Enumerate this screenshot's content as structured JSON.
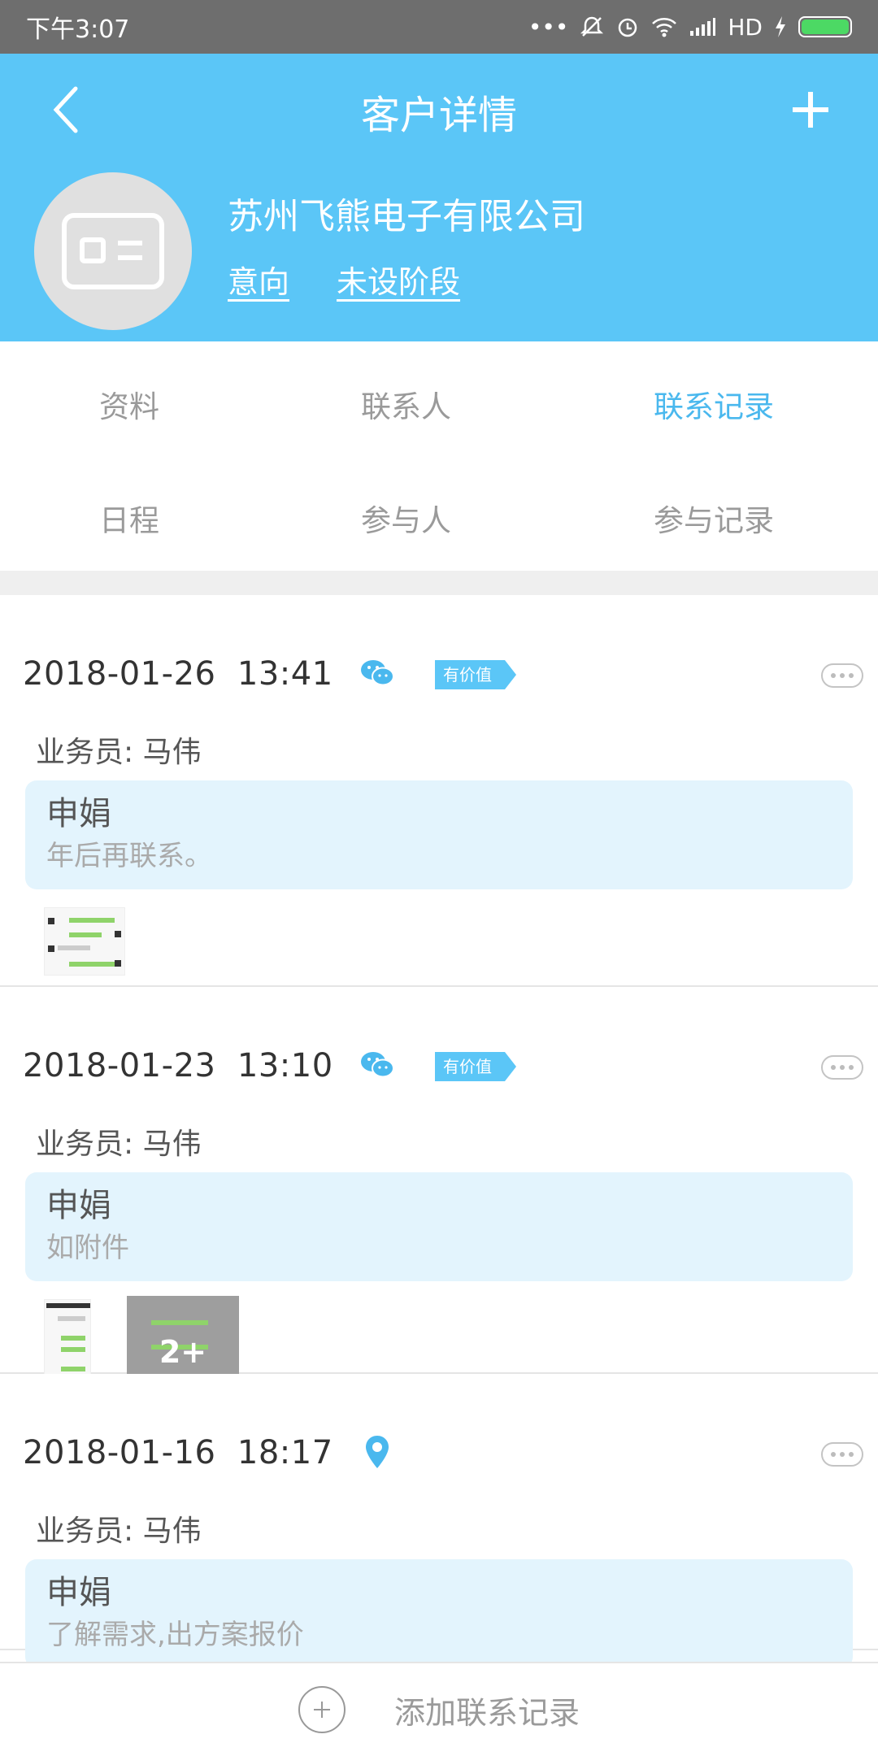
{
  "status_bar": {
    "time": "下午3:07",
    "network": "HD"
  },
  "header": {
    "title": "客户详情",
    "company_name": "苏州飞熊电子有限公司",
    "intent_link": "意向",
    "stage_link": "未设阶段"
  },
  "tabs": [
    {
      "label": "资料",
      "active": false
    },
    {
      "label": "联系人",
      "active": false
    },
    {
      "label": "联系记录",
      "active": true
    },
    {
      "label": "日程",
      "active": false
    },
    {
      "label": "参与人",
      "active": false
    },
    {
      "label": "参与记录",
      "active": false
    }
  ],
  "records": [
    {
      "date": "2018-01-26",
      "time": "13:41",
      "datetime": "2018-01-26  13:41",
      "type_icon": "wechat-icon",
      "tag": "有价值",
      "salesperson": "业务员: 马伟",
      "contact": "申娟",
      "note": "年后再联系。",
      "attachments": 1
    },
    {
      "date": "2018-01-23",
      "time": "13:10",
      "datetime": "2018-01-23  13:10",
      "type_icon": "wechat-icon",
      "tag": "有价值",
      "salesperson": "业务员: 马伟",
      "contact": "申娟",
      "note": "如附件",
      "attachments": 2,
      "more_attachments_label": "2+"
    },
    {
      "date": "2018-01-16",
      "time": "18:17",
      "datetime": "2018-01-16  18:17",
      "type_icon": "location-pin-icon",
      "salesperson": "业务员: 马伟",
      "contact": "申娟",
      "note": "了解需求,出方案报价"
    }
  ],
  "footer": {
    "add_label": "添加联系记录"
  },
  "colors": {
    "header_bg": "#5bc6f7",
    "active_tab": "#4ab8ee",
    "card_bg": "#e3f4fd"
  }
}
